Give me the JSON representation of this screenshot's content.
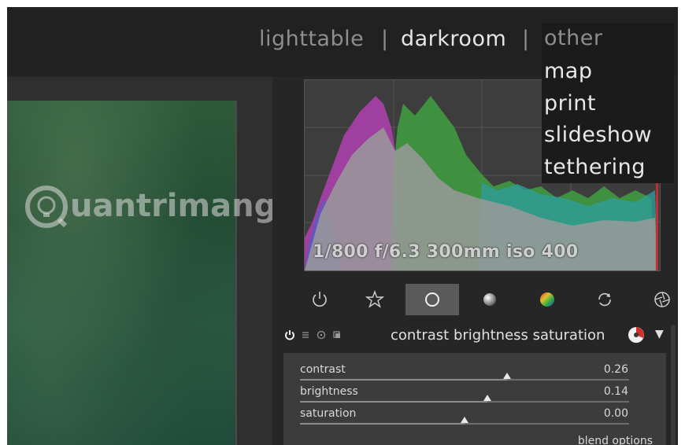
{
  "views": {
    "lighttable": "lighttable",
    "separator": "|",
    "darkroom": "darkroom",
    "separator2": "|"
  },
  "dropdown": {
    "items": [
      "other",
      "map",
      "print",
      "slideshow",
      "tethering"
    ]
  },
  "watermark": "uantrimang",
  "histogram": {
    "exif": "1/800 f/6.3 300mm iso 400"
  },
  "module_tabs": [
    {
      "icon": "power-icon",
      "active": false
    },
    {
      "icon": "star-icon",
      "active": false
    },
    {
      "icon": "circle-icon",
      "active": true
    },
    {
      "icon": "sphere-icon",
      "active": false
    },
    {
      "icon": "color-wheel-icon",
      "active": false
    },
    {
      "icon": "refresh-icon",
      "active": false
    },
    {
      "icon": "aperture-icon",
      "active": false
    }
  ],
  "module": {
    "title": "contrast brightness saturation",
    "collapse": "▼",
    "sliders": [
      {
        "label": "contrast",
        "value": "0.26",
        "position": 0.63
      },
      {
        "label": "brightness",
        "value": "0.14",
        "position": 0.57
      },
      {
        "label": "saturation",
        "value": "0.00",
        "position": 0.5
      }
    ],
    "blend_options": "blend options"
  },
  "colors": {
    "accent_active_tab": "#5a5a5a",
    "panel_bg": "#262626",
    "topbar_bg": "#212121"
  }
}
